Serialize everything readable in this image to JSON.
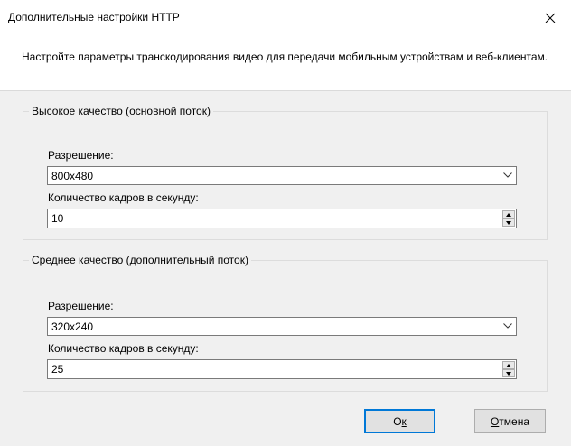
{
  "window": {
    "title": "Дополнительные настройки HTTP"
  },
  "header": {
    "description": "Настройте параметры транскодирования видео для передачи мобильным устройствам и веб-клиентам."
  },
  "groups": [
    {
      "title": "Высокое качество (основной поток)",
      "resolution_label": "Разрешение:",
      "resolution_value": "800x480",
      "fps_label": "Количество кадров в секунду:",
      "fps_value": "10"
    },
    {
      "title": "Среднее качество (дополнительный поток)",
      "resolution_label": "Разрешение:",
      "resolution_value": "320x240",
      "fps_label": "Количество кадров в секунду:",
      "fps_value": "25"
    }
  ],
  "buttons": {
    "ok_prefix": "О",
    "ok_mnemonic": "к",
    "cancel_mnemonic": "О",
    "cancel_rest": "тмена"
  },
  "icons": {
    "close": "close-icon",
    "dropdown": "chevron-down-icon",
    "spin_up": "triangle-up-icon",
    "spin_down": "triangle-down-icon"
  },
  "colors": {
    "default_button_border": "#0078d7",
    "window_bg": "#f0f0f0",
    "header_bg": "#ffffff"
  }
}
